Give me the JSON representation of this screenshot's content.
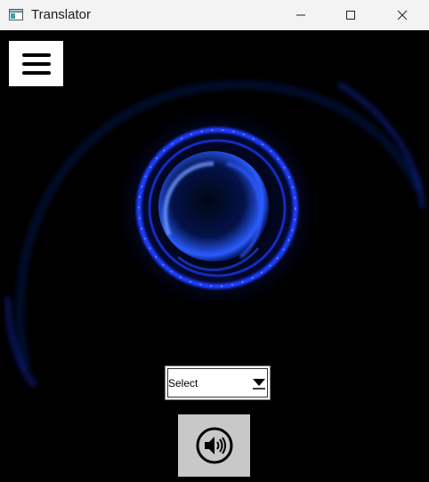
{
  "window": {
    "title": "Translator",
    "icons": [
      "app-window-icon",
      "minimize-icon",
      "maximize-icon",
      "close-icon"
    ]
  },
  "toolbar": {
    "menu_icon": "hamburger-menu-icon"
  },
  "language_select": {
    "selected": "Select"
  },
  "speak_button": {
    "icon": "speaker-icon"
  },
  "colors": {
    "background": "#000000",
    "orb_blue": "#2a5cff",
    "glow_blue": "#1f3dff",
    "button_gray": "#c8c8c8",
    "titlebar": "#f3f3f3"
  }
}
